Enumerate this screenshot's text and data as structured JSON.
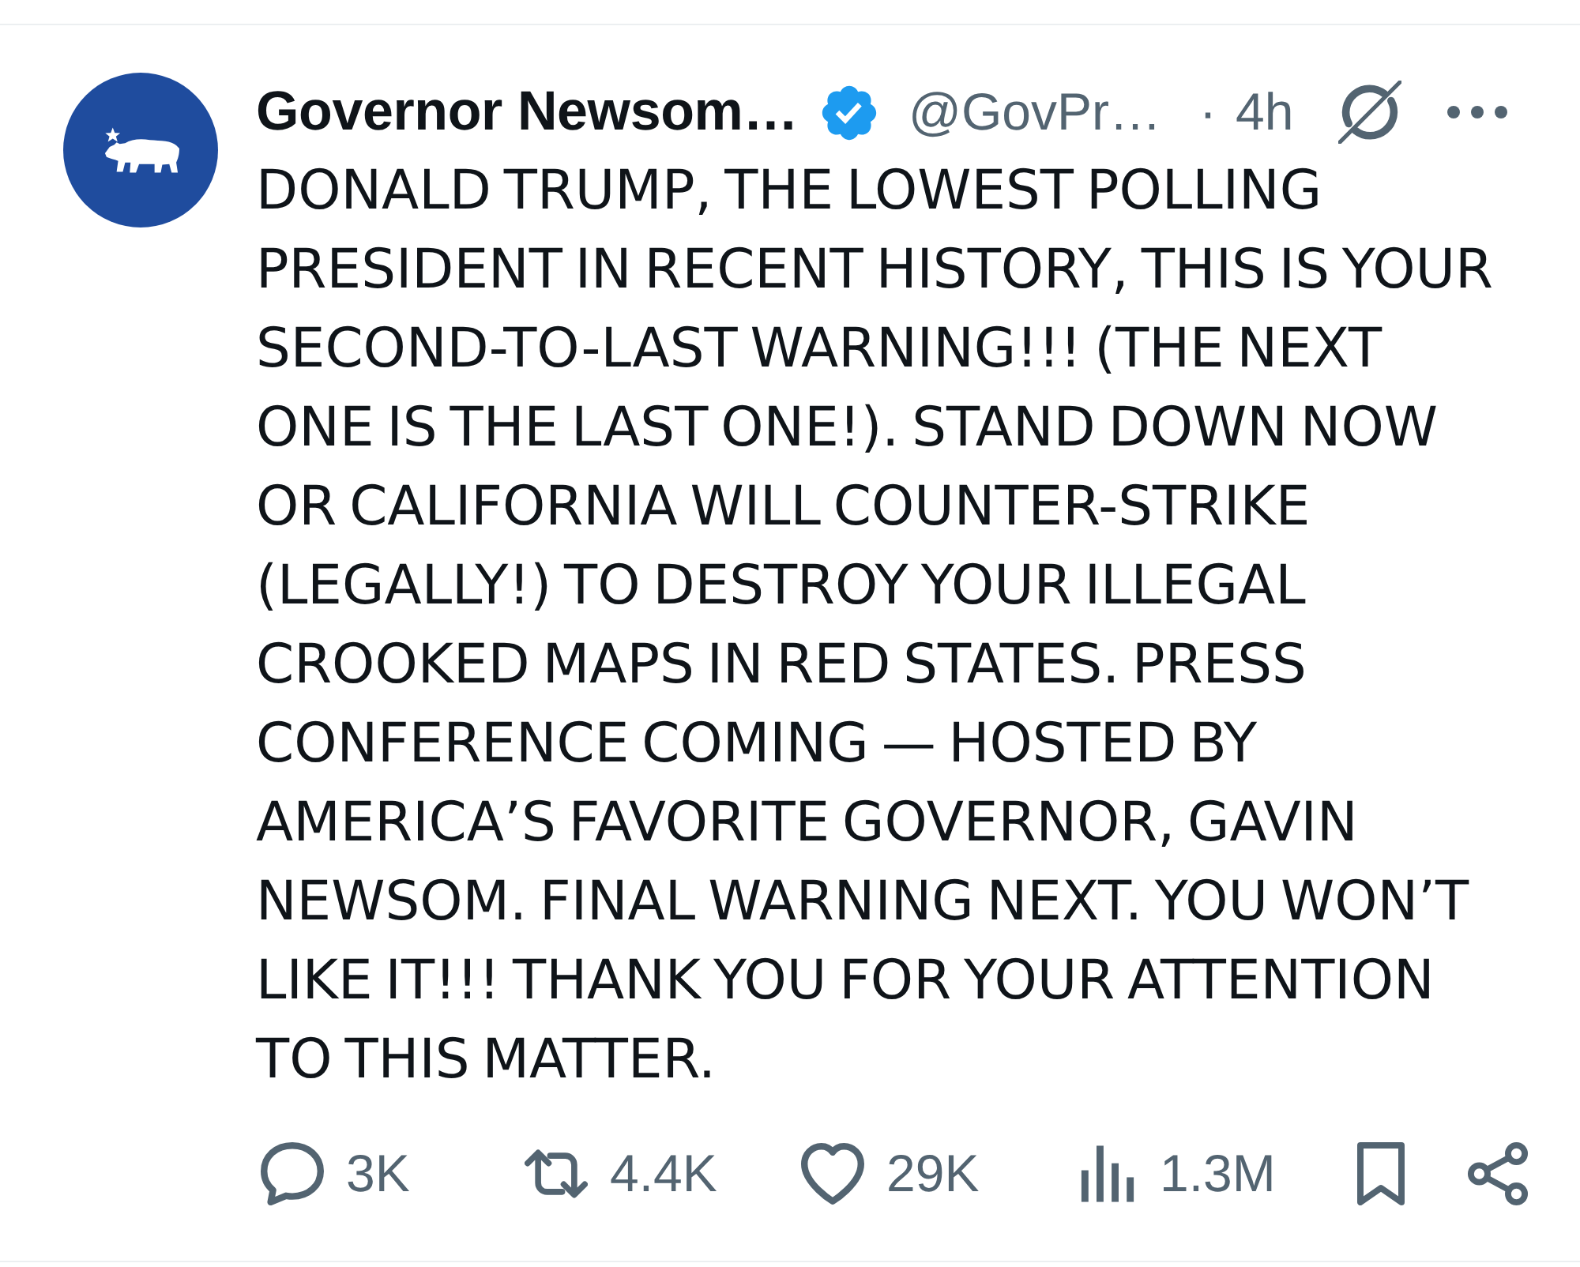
{
  "post": {
    "author": {
      "name": "Governor Newsom…",
      "verified": true,
      "handle": "@GovPr…",
      "separator": "·",
      "time": "4h"
    },
    "text": "DONALD TRUMP, THE LOWEST POLLING PRESIDENT IN RECENT HISTORY, THIS IS YOUR SECOND-TO-LAST WARNING!!! (THE NEXT ONE IS THE LAST ONE!). STAND DOWN NOW OR CALIFORNIA WILL COUNTER-STRIKE (LEGALLY!) TO DESTROY YOUR ILLEGAL CROOKED MAPS IN RED STATES. PRESS CONFERENCE COMING — HOSTED BY AMERICA’S FAVORITE GOVERNOR, GAVIN NEWSOM. FINAL WARNING NEXT. YOU WON’T LIKE IT!!! THANK YOU FOR YOUR ATTENTION TO THIS MATTER.",
    "actions": [
      {
        "kind": "reply",
        "count": "3K"
      },
      {
        "kind": "repost",
        "count": "4.4K"
      },
      {
        "kind": "like",
        "count": "29K"
      },
      {
        "kind": "views",
        "count": "1.3M"
      },
      {
        "kind": "bookmark"
      },
      {
        "kind": "share"
      }
    ]
  }
}
